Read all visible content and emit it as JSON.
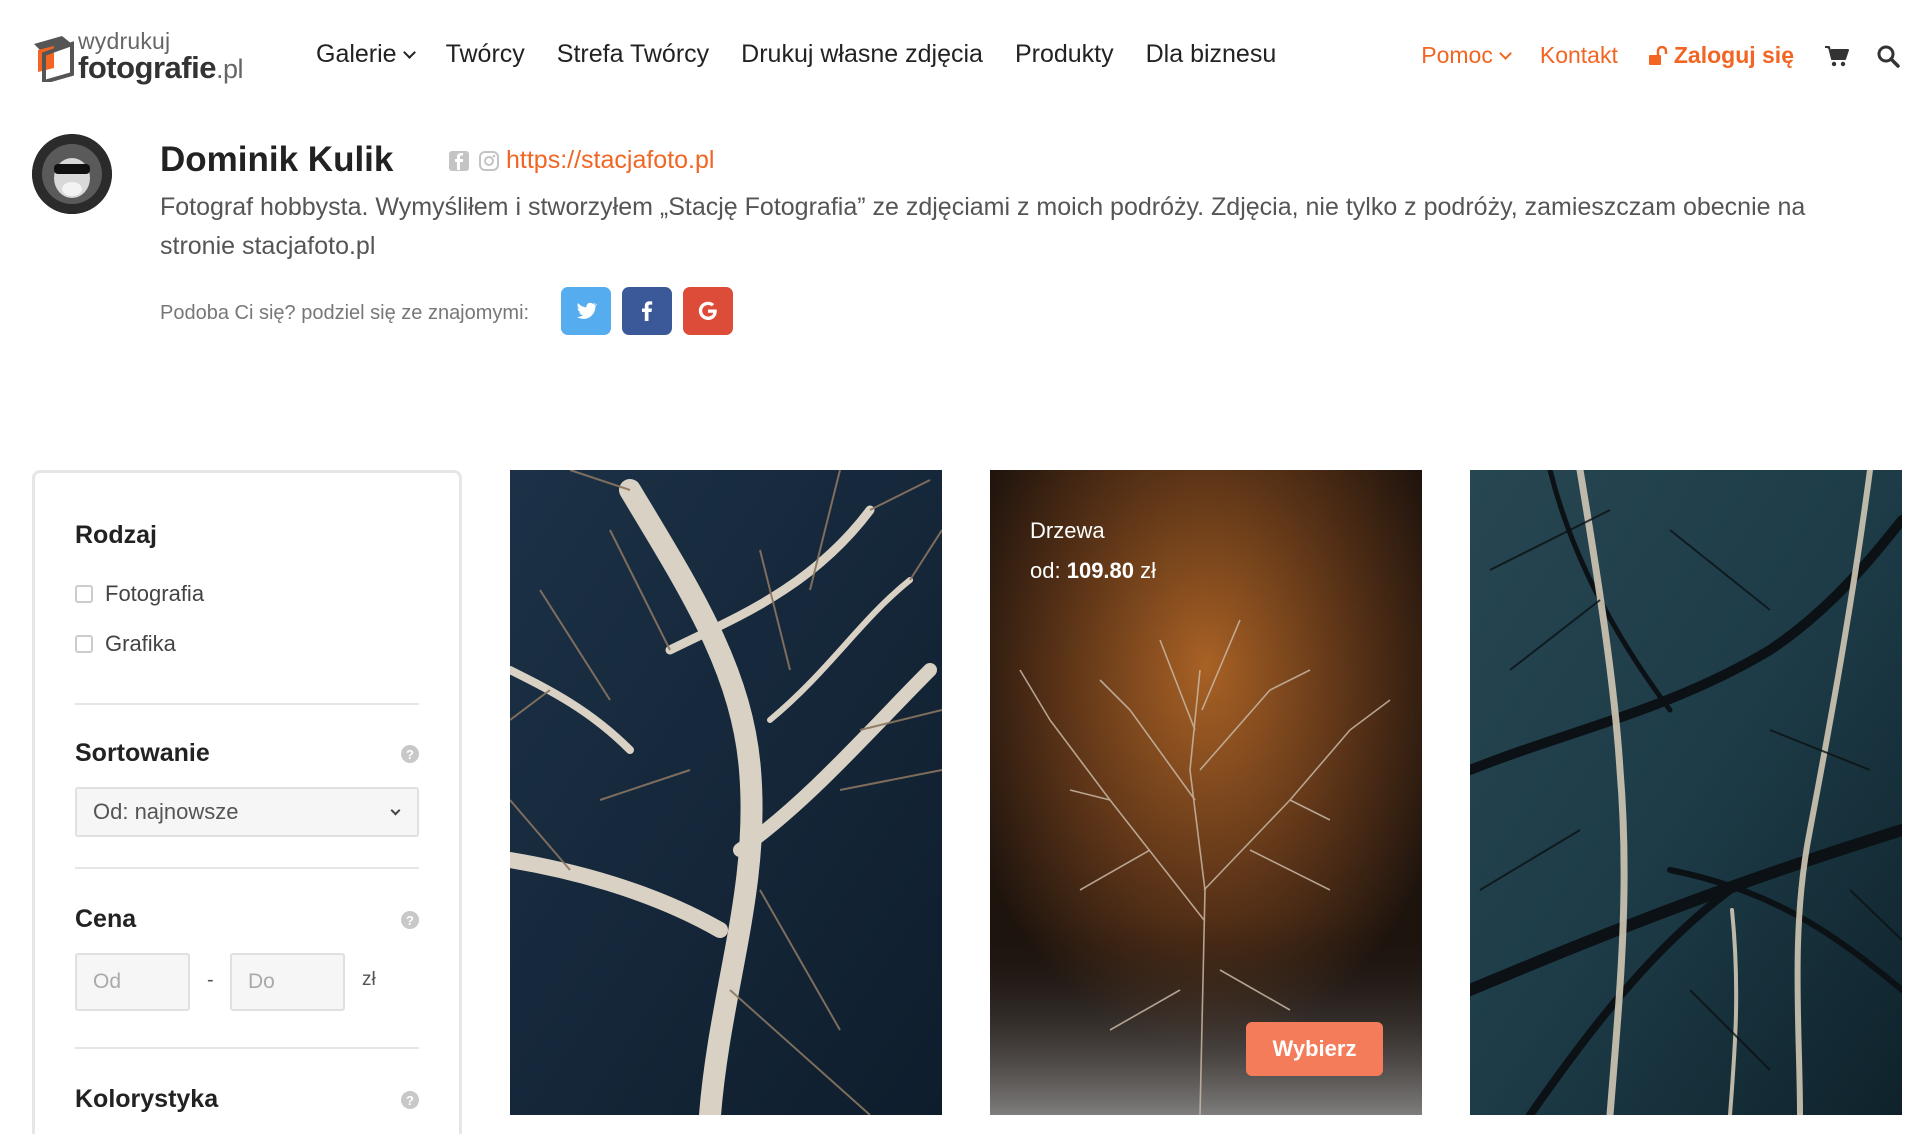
{
  "brand": {
    "logo_top": "wydrukuj",
    "logo_bottom": "fotografie",
    "logo_suffix": ".pl"
  },
  "nav": {
    "items": [
      {
        "label": "Galerie",
        "has_dropdown": true
      },
      {
        "label": "Twórcy"
      },
      {
        "label": "Strefa Twórcy"
      },
      {
        "label": "Drukuj własne zdjęcia"
      },
      {
        "label": "Produkty"
      },
      {
        "label": "Dla biznesu"
      }
    ],
    "right": {
      "help": "Pomoc",
      "contact": "Kontakt",
      "login": "Zaloguj się"
    }
  },
  "profile": {
    "name": "Dominik Kulik",
    "website": "https://stacjafoto.pl",
    "bio": "Fotograf hobbysta. Wymyśliłem i stworzyłem „Stację Fotografia” ze zdjęciami z moich podróży. Zdjęcia, nie tylko z podróży, zamieszczam obecnie na stronie stacjafoto.pl",
    "share_label": "Podoba Ci się? podziel się ze znajomymi:"
  },
  "filters": {
    "type": {
      "title": "Rodzaj",
      "options": [
        "Fotografia",
        "Grafika"
      ]
    },
    "sort": {
      "title": "Sortowanie",
      "selected": "Od: najnowsze"
    },
    "price": {
      "title": "Cena",
      "from_placeholder": "Od",
      "to_placeholder": "Do",
      "separator": "-",
      "currency": "zł"
    },
    "color": {
      "title": "Kolorystyka"
    }
  },
  "photos": [
    {
      "title": "",
      "price": ""
    },
    {
      "title": "Drzewa",
      "price_prefix": "od:",
      "price": "109.80",
      "currency": "zł",
      "button": "Wybierz"
    },
    {
      "title": "",
      "price": ""
    }
  ],
  "colors": {
    "accent": "#f26522",
    "twitter": "#55acee",
    "facebook": "#3b5998",
    "google": "#dd4b39",
    "choose_button": "#f47c5a"
  }
}
